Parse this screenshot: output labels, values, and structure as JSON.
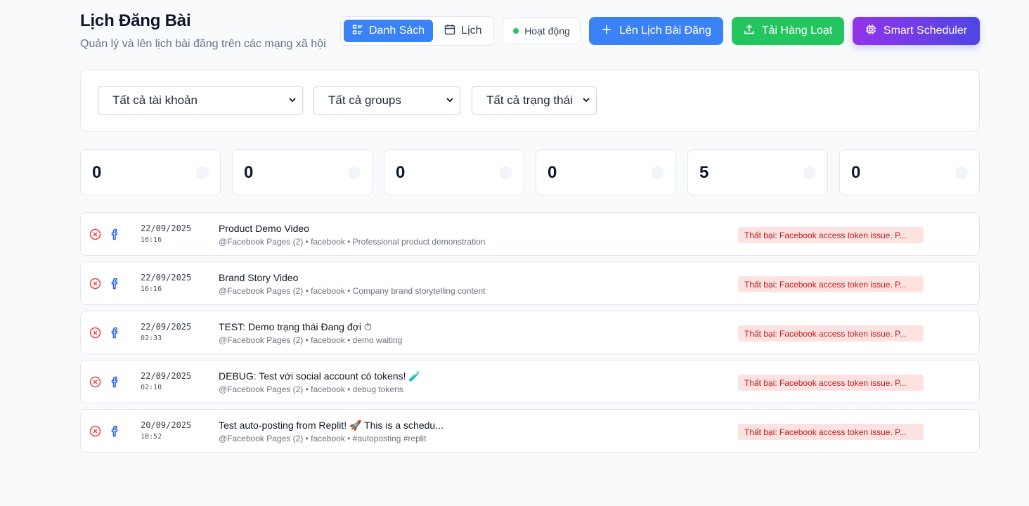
{
  "header": {
    "title": "Lịch Đăng Bài",
    "subtitle": "Quản lý và lên lịch bài đăng trên các mạng xã hội"
  },
  "view_toggle": {
    "list_label": "Danh Sách",
    "calendar_label": "Lịch",
    "active": "list"
  },
  "status": {
    "label": "Hoạt động",
    "color": "#22c55e"
  },
  "actions": {
    "schedule_label": "Lên Lịch Bài Đăng",
    "bulk_upload_label": "Tải Hàng Loạt",
    "smart_scheduler_label": "Smart Scheduler"
  },
  "filters": {
    "account": "Tất cả tài khoản",
    "group": "Tất cả groups",
    "status": "Tất cả trạng thái"
  },
  "stats": [
    "0",
    "0",
    "0",
    "0",
    "5",
    "0"
  ],
  "posts": [
    {
      "date": "22/09/2025",
      "time": "16:16",
      "title": "Product Demo Video",
      "title_emoji": "",
      "meta": "@Facebook Pages (2) • facebook • Professional product demonstration",
      "error": "Thất bại: Facebook access token issue. P...",
      "status_icon": "x-circle-icon",
      "platform_icon": "facebook-icon"
    },
    {
      "date": "22/09/2025",
      "time": "16:16",
      "title": "Brand Story Video",
      "title_emoji": "",
      "meta": "@Facebook Pages (2) • facebook • Company brand storytelling content",
      "error": "Thất bại: Facebook access token issue. P...",
      "status_icon": "x-circle-icon",
      "platform_icon": "facebook-icon"
    },
    {
      "date": "22/09/2025",
      "time": "02:33",
      "title": "TEST: Demo trạng thái Đang đợi",
      "title_emoji": "⏱",
      "meta": "@Facebook Pages (2) • facebook • demo waiting",
      "error": "Thất bại: Facebook access token issue. P...",
      "status_icon": "x-circle-icon",
      "platform_icon": "facebook-icon"
    },
    {
      "date": "22/09/2025",
      "time": "02:10",
      "title": "DEBUG: Test với social account có tokens!",
      "title_emoji": "🧪",
      "meta": "@Facebook Pages (2) • facebook • debug tokens",
      "error": "Thất bại: Facebook access token issue. P...",
      "status_icon": "x-circle-icon",
      "platform_icon": "facebook-icon"
    },
    {
      "date": "20/09/2025",
      "time": "18:52",
      "title": "Test auto-posting from Replit! 🚀 This is a schedu...",
      "title_emoji": "",
      "meta": "@Facebook Pages (2) • facebook • #autoposting #replit",
      "error": "Thất bại: Facebook access token issue. P...",
      "status_icon": "x-circle-icon",
      "platform_icon": "facebook-icon"
    }
  ],
  "colors": {
    "primary": "#3b82f6",
    "success": "#22c55e",
    "error_bg": "#fee2e2",
    "error_text": "#b91c1c",
    "facebook": "#2563eb"
  }
}
